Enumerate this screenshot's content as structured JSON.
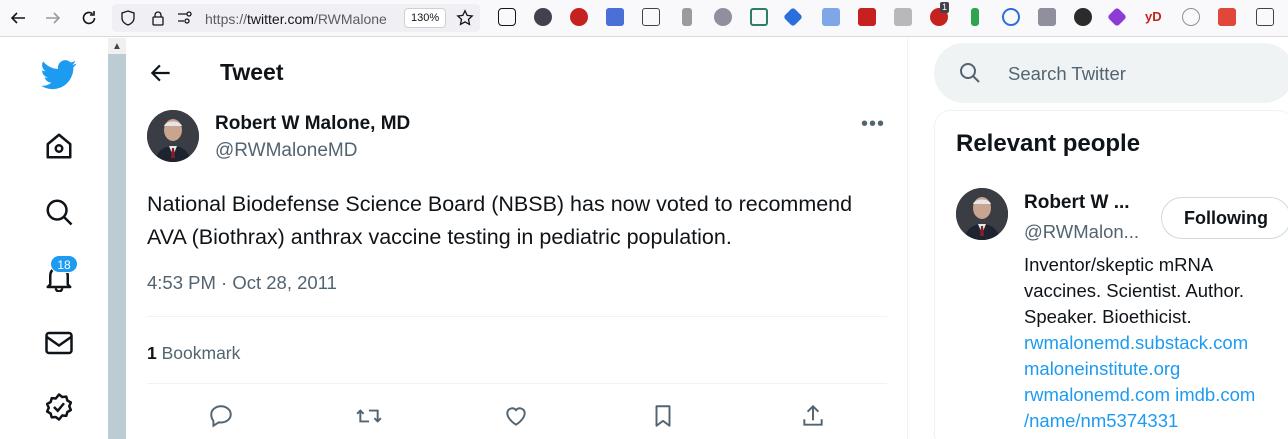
{
  "browser": {
    "url_prefix": "https://",
    "url_host": "twitter.com",
    "url_path": "/RWMalone",
    "zoom": "130%",
    "extension_badge": "1"
  },
  "sidebar": {
    "notifications_count": "18"
  },
  "header": {
    "title": "Tweet"
  },
  "tweet": {
    "author_name": "Robert W Malone, MD",
    "author_handle": "@RWMaloneMD",
    "text_line1": "National Biodefense Science Board (NBSB) has now voted to recommend",
    "text_line2": "AVA (Biothrax) anthrax vaccine testing in pediatric population.",
    "timestamp": "4:53 PM · Oct 28, 2011",
    "bookmark_count": "1",
    "bookmark_label": "Bookmark"
  },
  "search": {
    "placeholder": "Search Twitter"
  },
  "relevant_people": {
    "title": "Relevant people",
    "person": {
      "name": "Robert W ...",
      "handle": "@RWMalon...",
      "follow_label": "Following",
      "bio_lines": [
        "Inventor/skeptic mRNA",
        "vaccines. Scientist. Author.",
        "Speaker. Bioethicist."
      ],
      "links": [
        "rwmalonemd.substack.com",
        "maloneinstitute.org",
        "rwmalonemd.com imdb.com",
        "/name/nm5374331"
      ]
    }
  },
  "colors": {
    "accent": "#1d9bf0",
    "text_primary": "#0f1419",
    "text_secondary": "#536471"
  }
}
